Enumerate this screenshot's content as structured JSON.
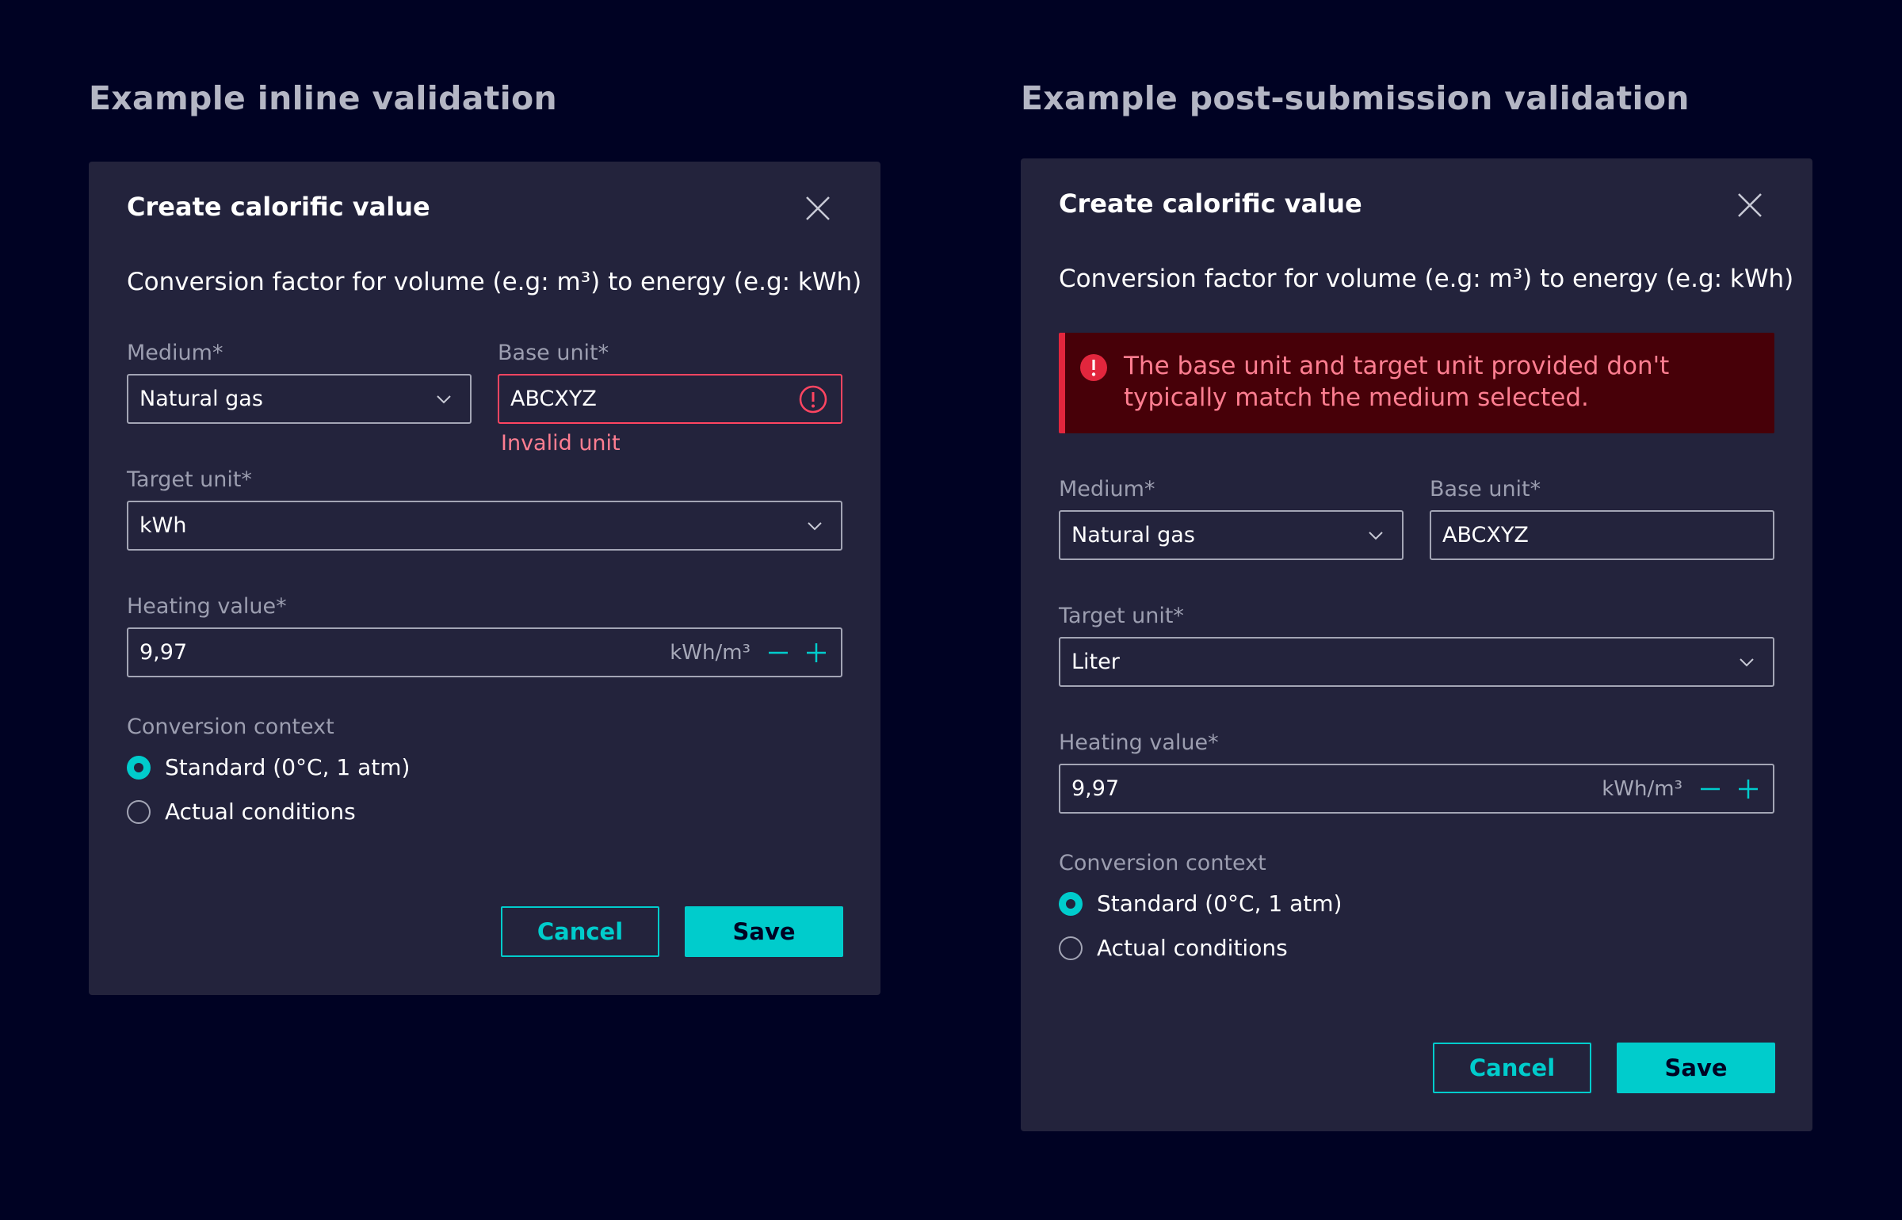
{
  "left": {
    "section_title": "Example inline validation",
    "dialog": {
      "title": "Create calorific value",
      "subtitle": "Conversion factor for volume (e.g: m³) to energy (e.g: kWh)",
      "medium": {
        "label": "Medium*",
        "value": "Natural gas"
      },
      "base_unit": {
        "label": "Base unit*",
        "value": "ABCXYZ",
        "error": "Invalid unit"
      },
      "target_unit": {
        "label": "Target unit*",
        "value": "kWh"
      },
      "heating_value": {
        "label": "Heating value*",
        "value": "9,97",
        "unit": "kWh/m³"
      },
      "context": {
        "label": "Conversion context",
        "options": [
          "Standard (0°C, 1 atm)",
          "Actual conditions"
        ],
        "selected": 0
      },
      "cancel_label": "Cancel",
      "save_label": "Save"
    }
  },
  "right": {
    "section_title": "Example post-submission validation",
    "dialog": {
      "title": "Create calorific value",
      "subtitle": "Conversion factor for volume (e.g: m³) to energy (e.g: kWh)",
      "banner": "The base unit and target unit provided don't typically match the medium selected.",
      "medium": {
        "label": "Medium*",
        "value": "Natural gas"
      },
      "base_unit": {
        "label": "Base unit*",
        "value": "ABCXYZ"
      },
      "target_unit": {
        "label": "Target unit*",
        "value": "Liter"
      },
      "heating_value": {
        "label": "Heating value*",
        "value": "9,97",
        "unit": "kWh/m³"
      },
      "context": {
        "label": "Conversion context",
        "options": [
          "Standard (0°C, 1 atm)",
          "Actual conditions"
        ],
        "selected": 0
      },
      "cancel_label": "Cancel",
      "save_label": "Save"
    }
  },
  "colors": {
    "background": "#000223",
    "dialog": "#23233c",
    "accent": "#00cccc",
    "error": "#ff4561",
    "error_text": "#ff7e91",
    "banner_bg": "#470008"
  },
  "icons": [
    "close-icon",
    "chevron-down-icon",
    "error-circle-icon",
    "minus-icon",
    "plus-icon"
  ]
}
